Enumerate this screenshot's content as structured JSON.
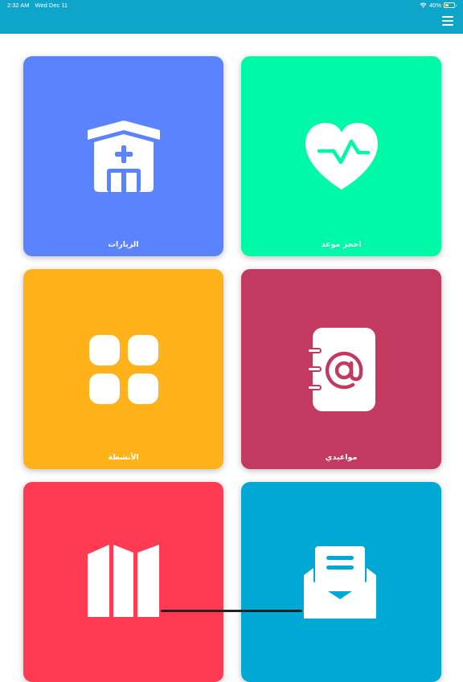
{
  "status_bar": {
    "time": "2:32 AM",
    "date": "Wed Dec 11",
    "battery": "40%",
    "battery_level": 0.4
  },
  "tiles": [
    {
      "label": "الزيارات",
      "color": "#5b82ff",
      "icon": "hospital-icon"
    },
    {
      "label": "احجز موعد",
      "color": "#00f9a7",
      "icon": "heart-pulse-icon"
    },
    {
      "label": "الأنشطة",
      "color": "#ffb21a",
      "icon": "grid-apps-icon"
    },
    {
      "label": "مواعيدي",
      "color": "#c23a5f",
      "icon": "address-book-icon"
    },
    {
      "label": "",
      "color": "#ff3a52",
      "icon": "map-icon"
    },
    {
      "label": "",
      "color": "#00a8d4",
      "icon": "open-envelope-icon"
    }
  ]
}
